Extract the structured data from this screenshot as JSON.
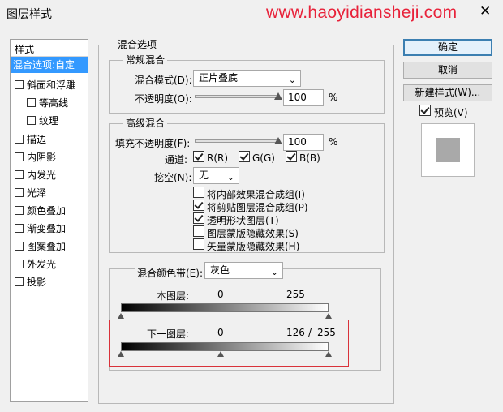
{
  "window": {
    "title": "图层样式",
    "watermark": "www.haoyidiansheji.com",
    "close": "✕"
  },
  "sidebar": {
    "header": "样式",
    "items": [
      {
        "label": "混合选项:自定",
        "checkbox": false,
        "selected": true
      },
      {
        "label": "斜面和浮雕",
        "checkbox": true
      },
      {
        "label": "等高线",
        "checkbox": true,
        "indent": true
      },
      {
        "label": "纹理",
        "checkbox": true,
        "indent": true
      },
      {
        "label": "描边",
        "checkbox": true
      },
      {
        "label": "内阴影",
        "checkbox": true
      },
      {
        "label": "内发光",
        "checkbox": true
      },
      {
        "label": "光泽",
        "checkbox": true
      },
      {
        "label": "颜色叠加",
        "checkbox": true
      },
      {
        "label": "渐变叠加",
        "checkbox": true
      },
      {
        "label": "图案叠加",
        "checkbox": true
      },
      {
        "label": "外发光",
        "checkbox": true
      },
      {
        "label": "投影",
        "checkbox": true
      }
    ]
  },
  "blend_options": {
    "legend": "混合选项",
    "general": {
      "legend": "常规混合",
      "mode_label": "混合模式(D):",
      "mode_value": "正片叠底",
      "opacity_label": "不透明度(O):",
      "opacity_value": "100",
      "opacity_unit": "%",
      "opacity_level": 1.0
    },
    "advanced": {
      "legend": "高级混合",
      "fill_label": "填充不透明度(F):",
      "fill_value": "100",
      "fill_unit": "%",
      "fill_level": 1.0,
      "channels_label": "通道:",
      "channels": [
        {
          "label": "R(R)",
          "checked": true
        },
        {
          "label": "G(G)",
          "checked": true
        },
        {
          "label": "B(B)",
          "checked": true
        }
      ],
      "knockout_label": "挖空(N):",
      "knockout_value": "无",
      "options": [
        {
          "label": "将内部效果混合成组(I)",
          "checked": false
        },
        {
          "label": "将剪贴图层混合成组(P)",
          "checked": true
        },
        {
          "label": "透明形状图层(T)",
          "checked": true
        },
        {
          "label": "图层蒙版隐藏效果(S)",
          "checked": false
        },
        {
          "label": "矢量蒙版隐藏效果(H)",
          "checked": false
        }
      ]
    },
    "blend_if": {
      "label": "混合颜色带(E):",
      "value": "灰色",
      "this_layer": {
        "label": "本图层:",
        "low": "0",
        "high": "255"
      },
      "underlying": {
        "label": "下一图层:",
        "low": "0",
        "high_split": "126",
        "separator": "/",
        "high": "255"
      }
    }
  },
  "buttons": {
    "ok": "确定",
    "cancel": "取消",
    "new_style": "新建样式(W)..."
  },
  "preview": {
    "label": "预览(V)",
    "checked": true
  },
  "colors": {
    "selection": "#3399ff",
    "highlight_box": "#d9323a",
    "watermark": "#e8223a",
    "default_button_border": "#3c7fb1"
  }
}
